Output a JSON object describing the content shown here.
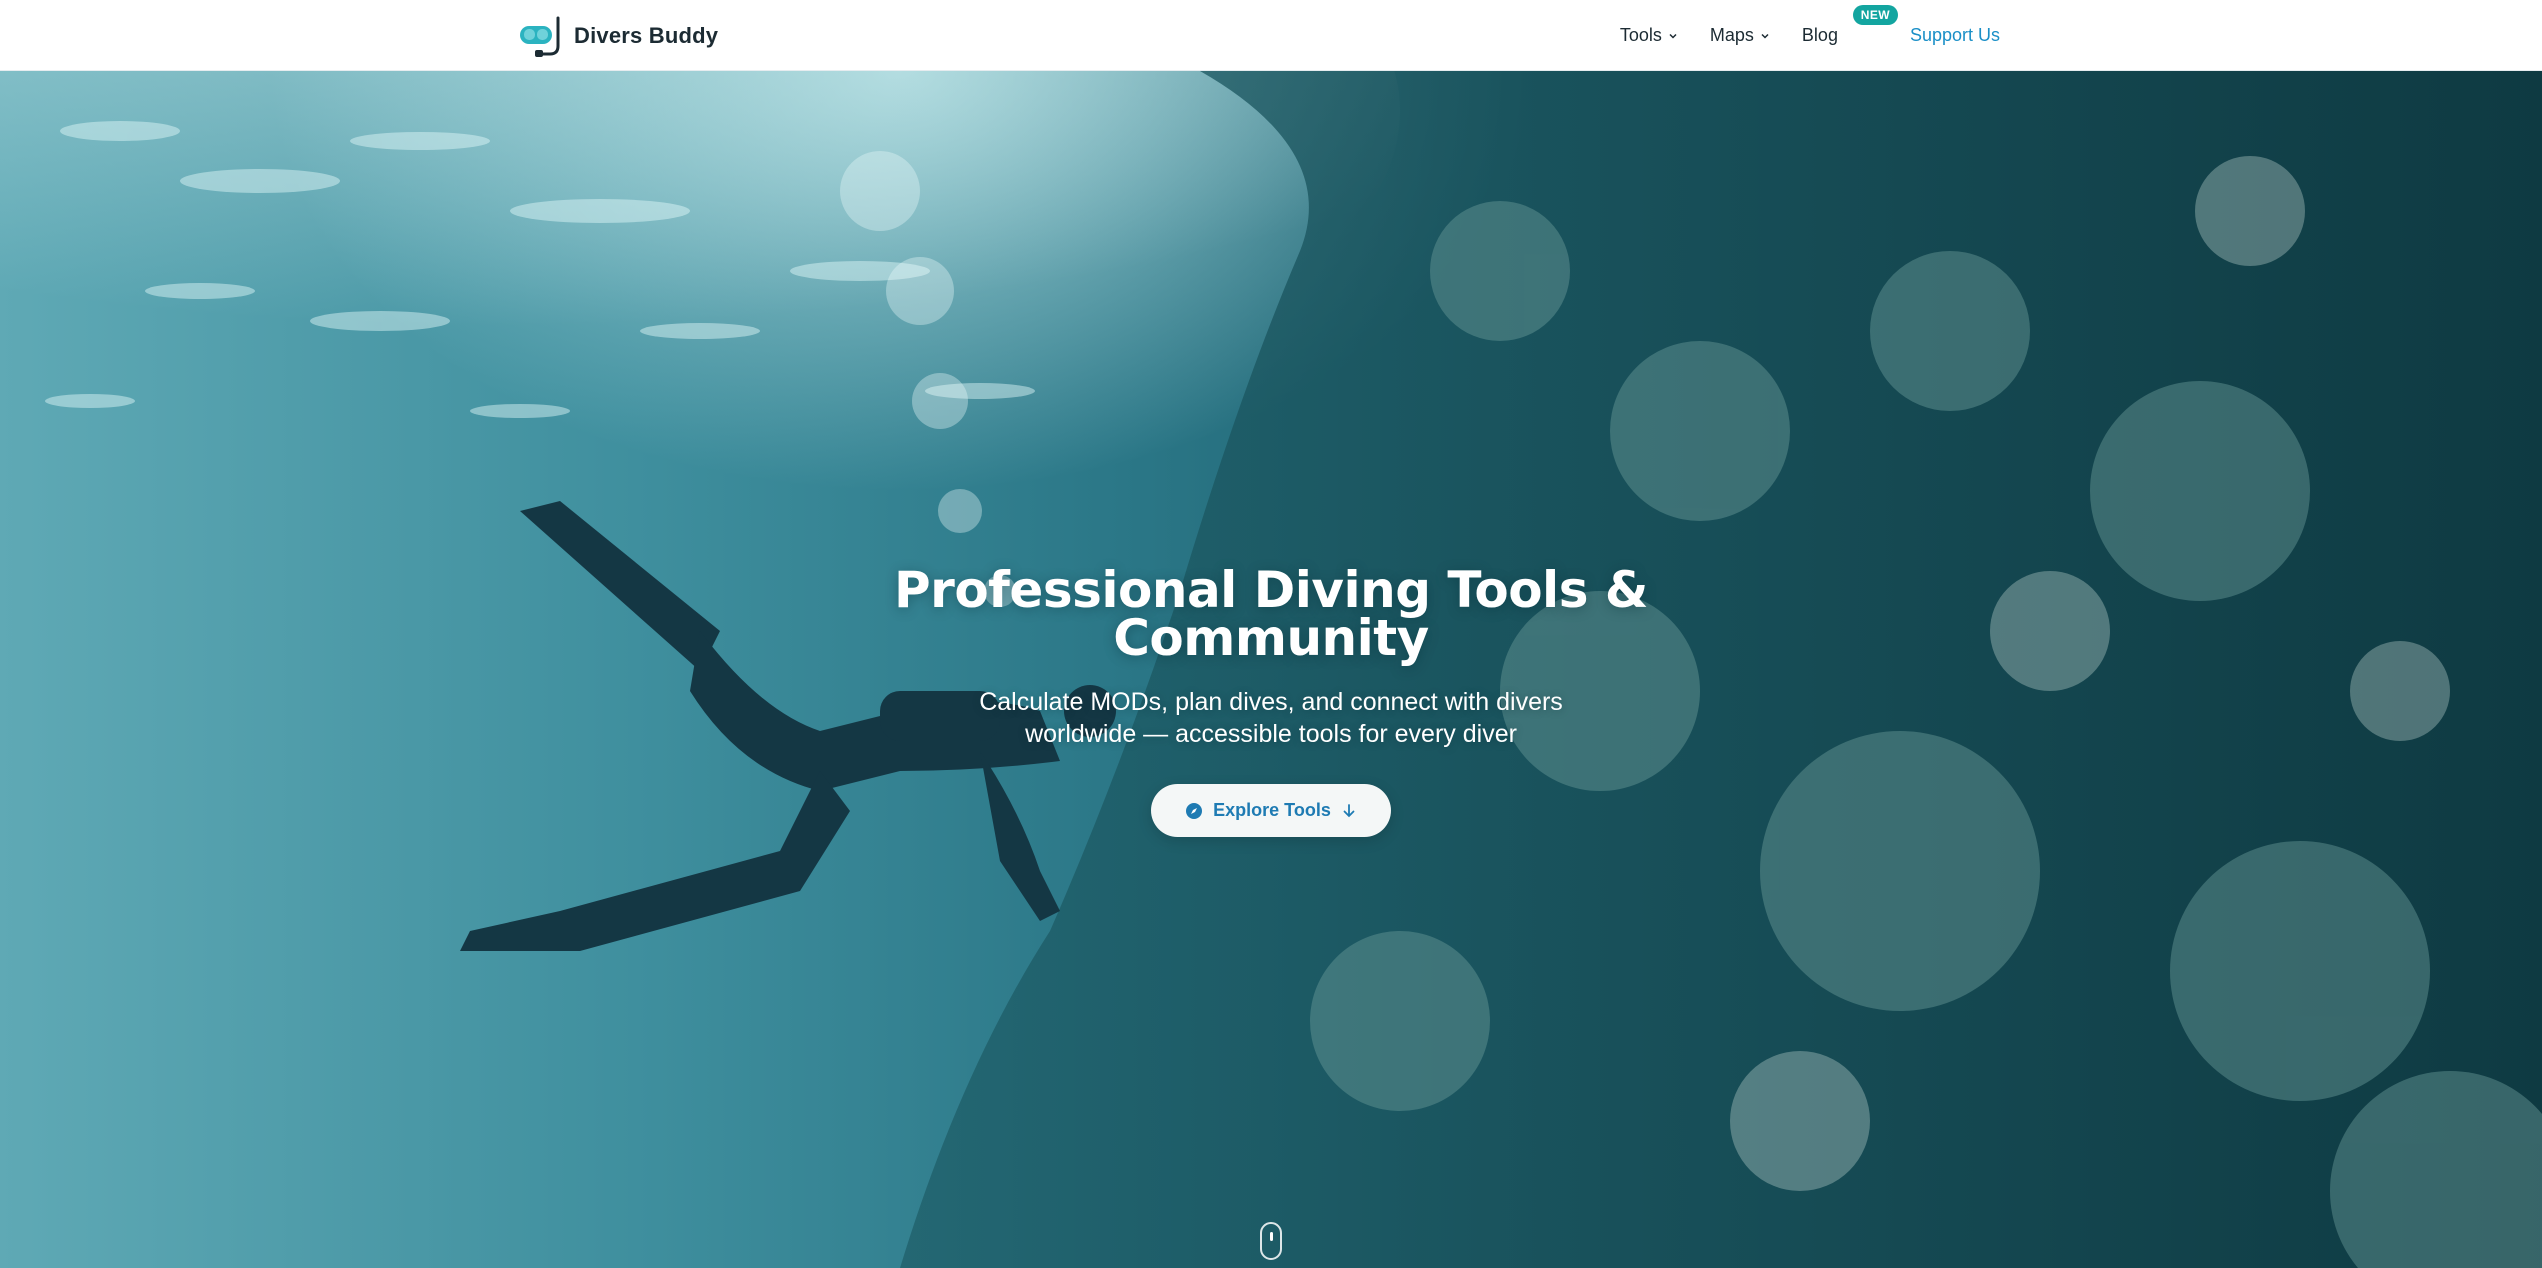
{
  "brand": {
    "name": "Divers Buddy",
    "logo_icon": "diving-mask-snorkel-icon",
    "accent": "#2bb3c0"
  },
  "nav": {
    "tools_label": "Tools",
    "maps_label": "Maps",
    "blog_label": "Blog",
    "blog_badge": "NEW",
    "support_label": "Support Us",
    "support_color": "#1a8fc7",
    "badge_color": "#13a5a0"
  },
  "hero": {
    "title": "Professional Diving Tools & Community",
    "subtitle": "Calculate MODs, plan dives, and connect with divers worldwide — accessible tools for every diver",
    "cta_label": "Explore Tools",
    "cta_icon": "compass-icon",
    "cta_arrow_icon": "arrow-down-icon",
    "scroll_icon": "mouse-scroll-icon",
    "background": "underwater-scene-diver-coral-reef"
  }
}
